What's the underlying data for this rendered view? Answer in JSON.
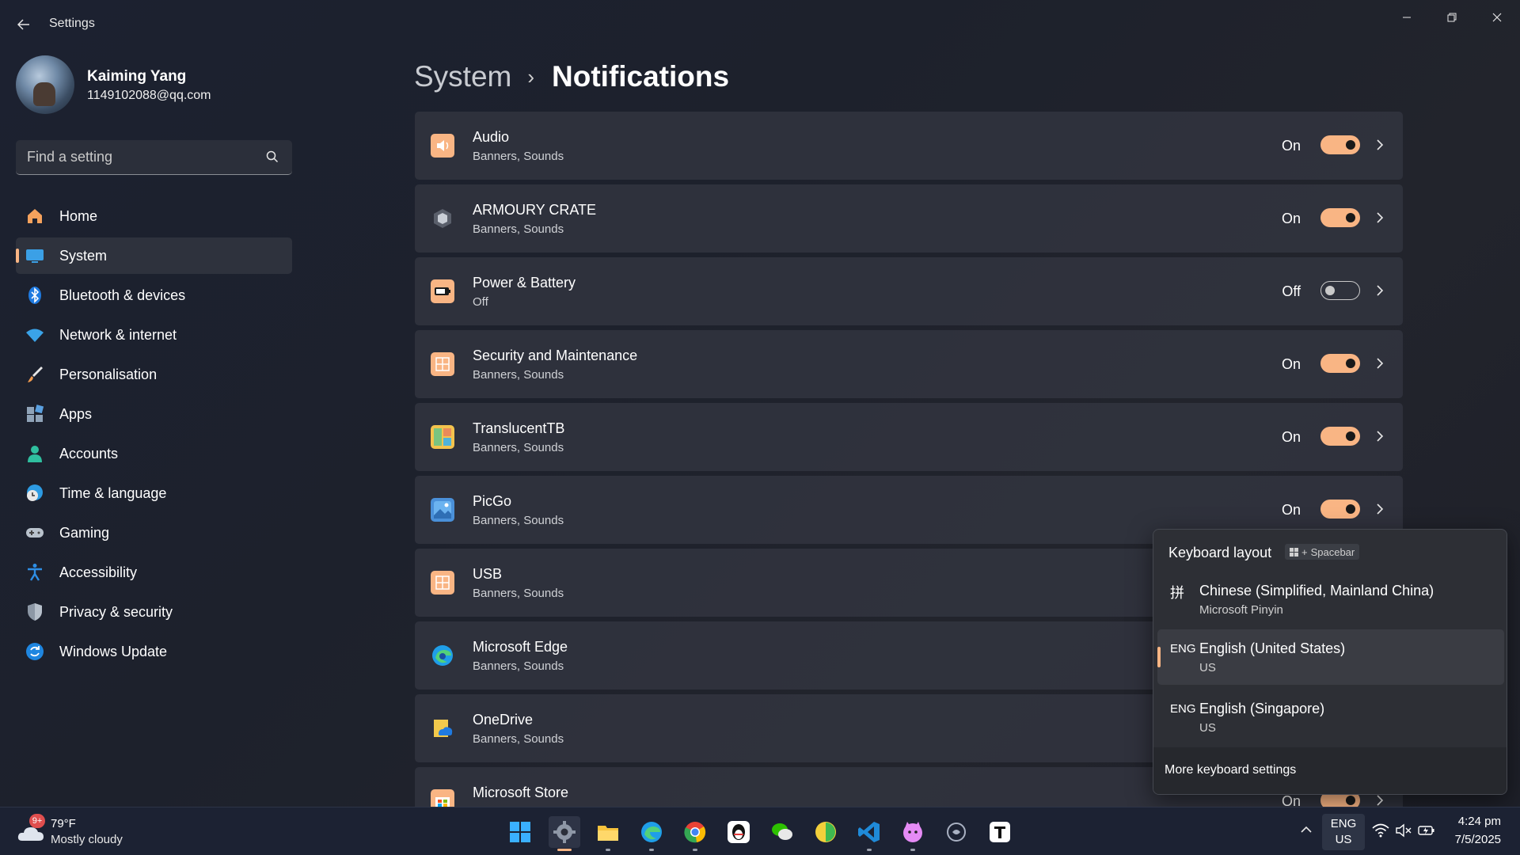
{
  "window": {
    "app_title": "Settings"
  },
  "profile": {
    "name": "Kaiming Yang",
    "email": "1149102088@qq.com"
  },
  "search": {
    "placeholder": "Find a setting",
    "value": ""
  },
  "sidebar": {
    "items": [
      {
        "label": "Home",
        "icon": "home-icon",
        "active": false
      },
      {
        "label": "System",
        "icon": "system-icon",
        "active": true
      },
      {
        "label": "Bluetooth & devices",
        "icon": "bluetooth-icon",
        "active": false
      },
      {
        "label": "Network & internet",
        "icon": "wifi-icon",
        "active": false
      },
      {
        "label": "Personalisation",
        "icon": "brush-icon",
        "active": false
      },
      {
        "label": "Apps",
        "icon": "apps-icon",
        "active": false
      },
      {
        "label": "Accounts",
        "icon": "account-icon",
        "active": false
      },
      {
        "label": "Time & language",
        "icon": "clock-globe-icon",
        "active": false
      },
      {
        "label": "Gaming",
        "icon": "gamepad-icon",
        "active": false
      },
      {
        "label": "Accessibility",
        "icon": "accessibility-icon",
        "active": false
      },
      {
        "label": "Privacy & security",
        "icon": "shield-icon",
        "active": false
      },
      {
        "label": "Windows Update",
        "icon": "update-icon",
        "active": false
      }
    ]
  },
  "header": {
    "parent": "System",
    "separator": "›",
    "current": "Notifications"
  },
  "notifications": {
    "items": [
      {
        "title": "Audio",
        "subtitle": "Banners, Sounds",
        "state": "On",
        "on": true,
        "icon": "audio-icon",
        "icon_color": "#f9b584"
      },
      {
        "title": "ARMOURY CRATE",
        "subtitle": "Banners, Sounds",
        "state": "On",
        "on": true,
        "icon": "armoury-crate-icon",
        "icon_color": "#5a5f6b"
      },
      {
        "title": "Power & Battery",
        "subtitle": "Off",
        "state": "Off",
        "on": false,
        "icon": "battery-icon",
        "icon_color": "#f9b584"
      },
      {
        "title": "Security and Maintenance",
        "subtitle": "Banners, Sounds",
        "state": "On",
        "on": true,
        "icon": "security-maintenance-icon",
        "icon_color": "#f9b584"
      },
      {
        "title": "TranslucentTB",
        "subtitle": "Banners, Sounds",
        "state": "On",
        "on": true,
        "icon": "translucenttb-icon",
        "icon_color": "#7ac47f"
      },
      {
        "title": "PicGo",
        "subtitle": "Banners, Sounds",
        "state": "On",
        "on": true,
        "icon": "picgo-icon",
        "icon_color": "#4a90d9"
      },
      {
        "title": "USB",
        "subtitle": "Banners, Sounds",
        "state": "",
        "on": null,
        "icon": "usb-icon",
        "icon_color": "#f9b584"
      },
      {
        "title": "Microsoft Edge",
        "subtitle": "Banners, Sounds",
        "state": "",
        "on": null,
        "icon": "edge-icon",
        "icon_color": "#1f9ee8"
      },
      {
        "title": "OneDrive",
        "subtitle": "Banners, Sounds",
        "state": "",
        "on": null,
        "icon": "onedrive-icon",
        "icon_color": "#f2c94c"
      },
      {
        "title": "Microsoft Store",
        "subtitle": "",
        "state": "On",
        "on": true,
        "icon": "store-icon",
        "icon_color": "#f9b584"
      }
    ]
  },
  "keyboard_flyout": {
    "title": "Keyboard layout",
    "shortcut_plus": "+",
    "shortcut_key": "Spacebar",
    "layouts": [
      {
        "code": "拼",
        "name": "Chinese (Simplified, Mainland China)",
        "sub": "Microsoft Pinyin",
        "selected": false
      },
      {
        "code": "ENG",
        "name": "English (United States)",
        "sub": "US",
        "selected": true
      },
      {
        "code": "ENG",
        "name": "English (Singapore)",
        "sub": "US",
        "selected": false
      }
    ],
    "more_link": "More keyboard settings"
  },
  "taskbar": {
    "weather": {
      "badge": "9+",
      "temp": "79°F",
      "desc": "Mostly cloudy"
    },
    "apps": [
      {
        "name": "start-icon",
        "active": false
      },
      {
        "name": "settings-icon",
        "active": true
      },
      {
        "name": "file-explorer-icon",
        "active": false
      },
      {
        "name": "edge-icon",
        "active": false
      },
      {
        "name": "chrome-icon",
        "active": false
      },
      {
        "name": "qq-icon",
        "active": false
      },
      {
        "name": "wechat-icon",
        "active": false
      },
      {
        "name": "app-green-icon",
        "active": false
      },
      {
        "name": "vscode-icon",
        "active": false
      },
      {
        "name": "cat-app-icon",
        "active": false
      },
      {
        "name": "circle-app-icon",
        "active": false
      },
      {
        "name": "typora-icon",
        "active": false
      }
    ],
    "ime": {
      "line1": "ENG",
      "line2": "US"
    },
    "clock": {
      "time": "4:24 pm",
      "date": "7/5/2025"
    }
  },
  "colors": {
    "accent": "#f9b584",
    "background": "#1d212c",
    "card": "#323641"
  }
}
